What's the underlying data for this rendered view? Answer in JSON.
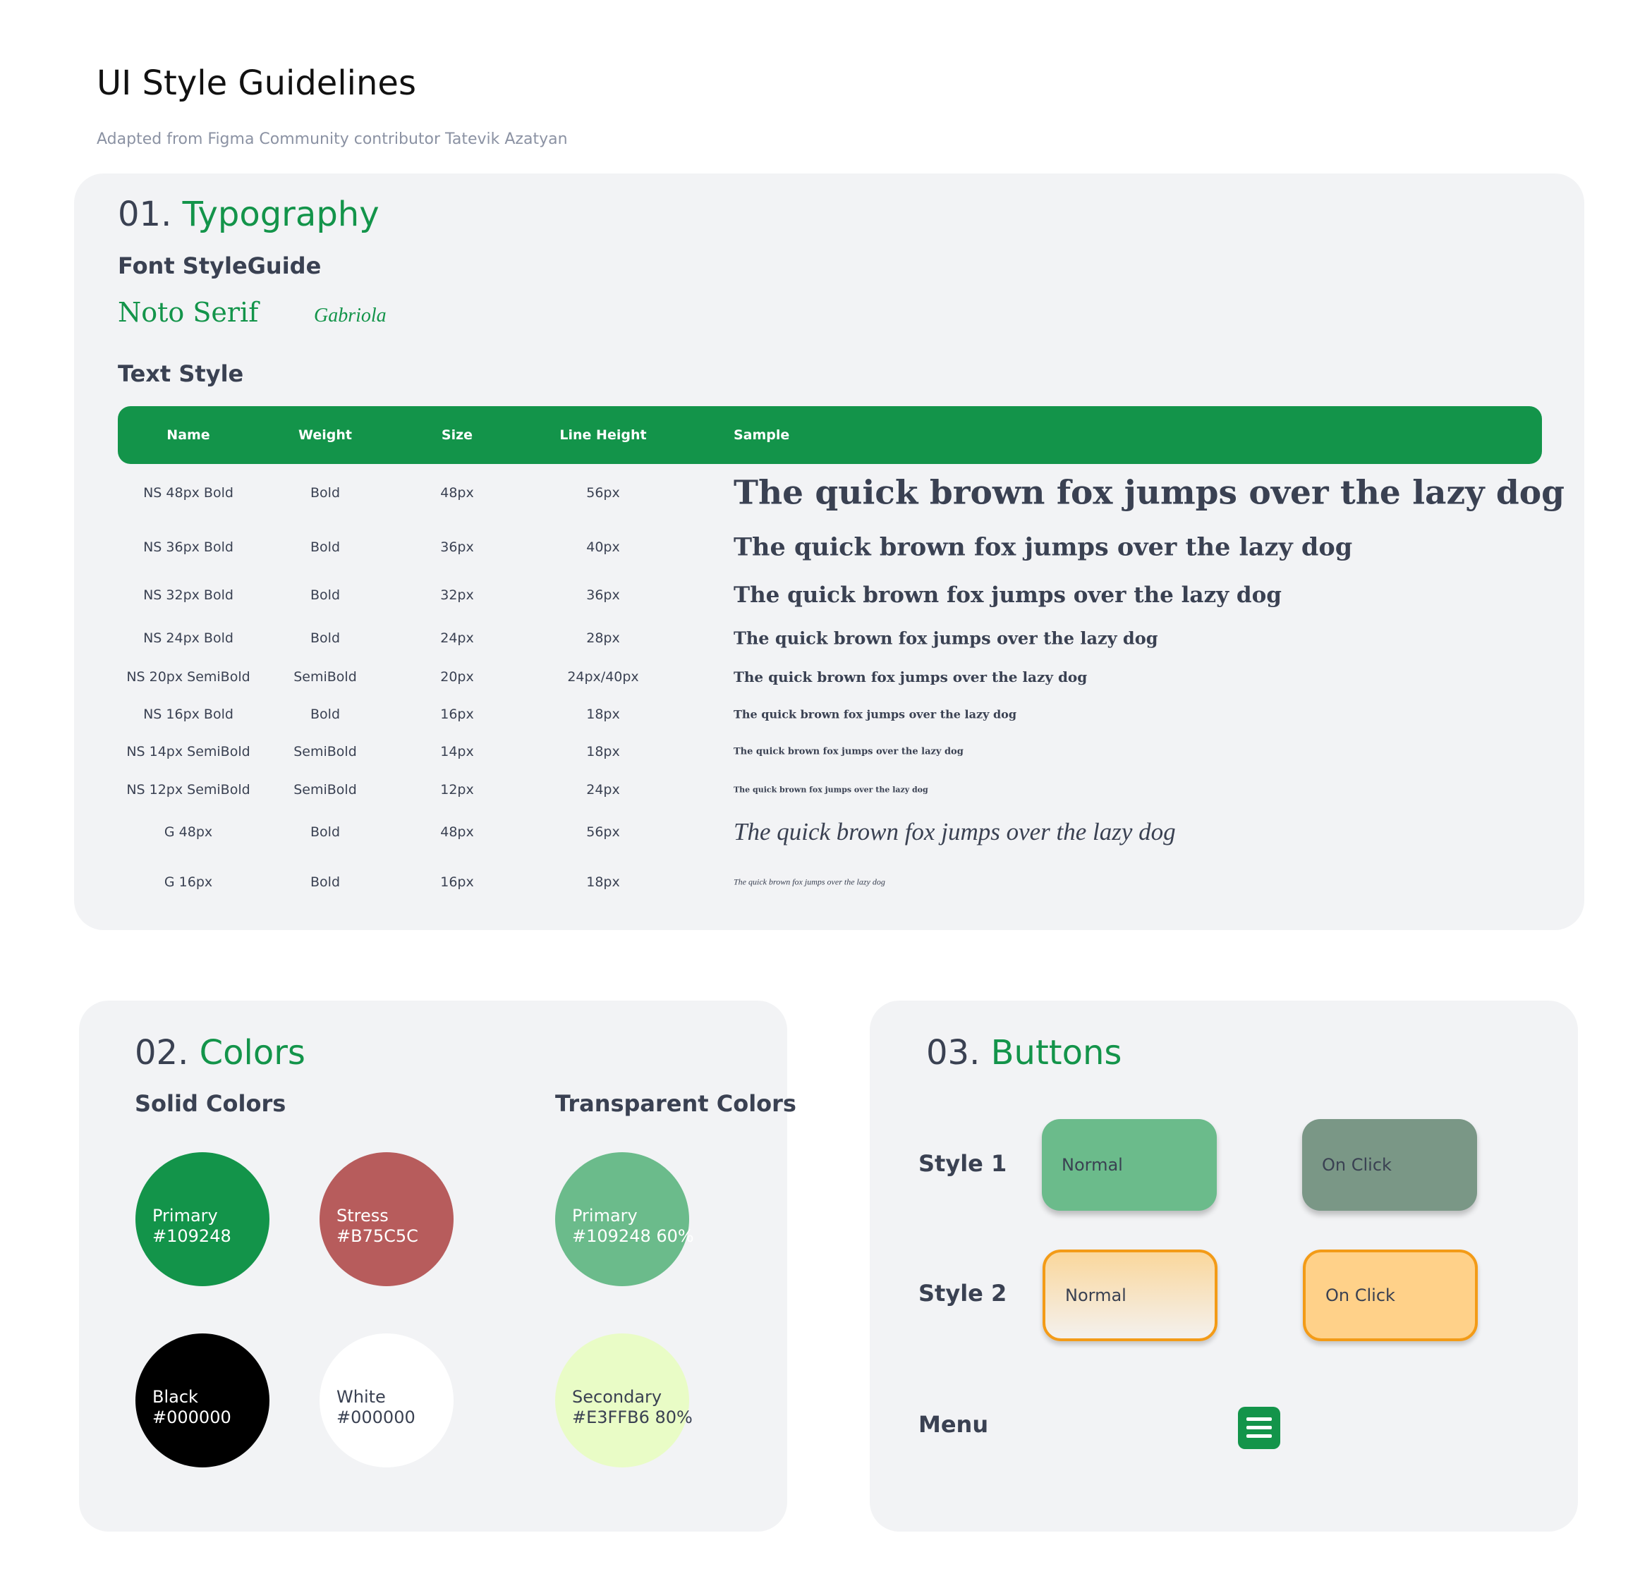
{
  "page": {
    "title": "UI Style Guidelines",
    "subtitle": "Adapted from Figma Community contributor Tatevik Azatyan"
  },
  "typography": {
    "number": "01.",
    "title": "Typography",
    "font_guide_heading": "Font StyleGuide",
    "fonts": [
      "Noto Serif",
      "Gabriola"
    ],
    "text_style_heading": "Text Style",
    "table": {
      "columns": [
        "Name",
        "Weight",
        "Size",
        "Line Height",
        "Sample"
      ],
      "sample_text": "The quick brown fox jumps over the lazy dog",
      "rows": [
        {
          "name": "NS 48px Bold",
          "weight": "Bold",
          "size": "48px",
          "line_height": "56px"
        },
        {
          "name": "NS 36px Bold",
          "weight": "Bold",
          "size": "36px",
          "line_height": "40px"
        },
        {
          "name": "NS 32px Bold",
          "weight": "Bold",
          "size": "32px",
          "line_height": "36px"
        },
        {
          "name": "NS 24px Bold",
          "weight": "Bold",
          "size": "24px",
          "line_height": "28px"
        },
        {
          "name": "NS 20px SemiBold",
          "weight": "SemiBold",
          "size": "20px",
          "line_height": "24px/40px"
        },
        {
          "name": "NS 16px Bold",
          "weight": "Bold",
          "size": "16px",
          "line_height": "18px"
        },
        {
          "name": "NS 14px SemiBold",
          "weight": "SemiBold",
          "size": "14px",
          "line_height": "18px"
        },
        {
          "name": "NS 12px SemiBold",
          "weight": "SemiBold",
          "size": "12px",
          "line_height": "24px"
        },
        {
          "name": "G 48px",
          "weight": "Bold",
          "size": "48px",
          "line_height": "56px"
        },
        {
          "name": "G 16px",
          "weight": "Bold",
          "size": "16px",
          "line_height": "18px"
        }
      ]
    }
  },
  "colors": {
    "number": "02.",
    "title": "Colors",
    "solid_heading": "Solid Colors",
    "transparent_heading": "Transparent Colors",
    "swatches": [
      {
        "label": "Primary",
        "value": "#109248",
        "fill": "#13944a",
        "text_color": "#ffffff"
      },
      {
        "label": "Stress",
        "value": "#B75C5C",
        "fill": "#b75c5c",
        "text_color": "#ffffff"
      },
      {
        "label": "Primary",
        "value": "#109248 60%",
        "fill": "#6bbb8b",
        "text_color": "#ffffff"
      },
      {
        "label": "Black",
        "value": "#000000",
        "fill": "#000000",
        "text_color": "#ffffff"
      },
      {
        "label": "White",
        "value": "#000000",
        "fill": "#ffffff",
        "text_color": "#3a4152"
      },
      {
        "label": "Secondary",
        "value": "#E3FFB6 80%",
        "fill": "#e9fcc6",
        "text_color": "#3a4152"
      }
    ]
  },
  "buttons": {
    "number": "03.",
    "title": "Buttons",
    "style1_label": "Style 1",
    "style2_label": "Style 2",
    "menu_label": "Menu",
    "normal_label": "Normal",
    "click_label": "On Click",
    "menu_icon": "hamburger-menu-icon"
  }
}
